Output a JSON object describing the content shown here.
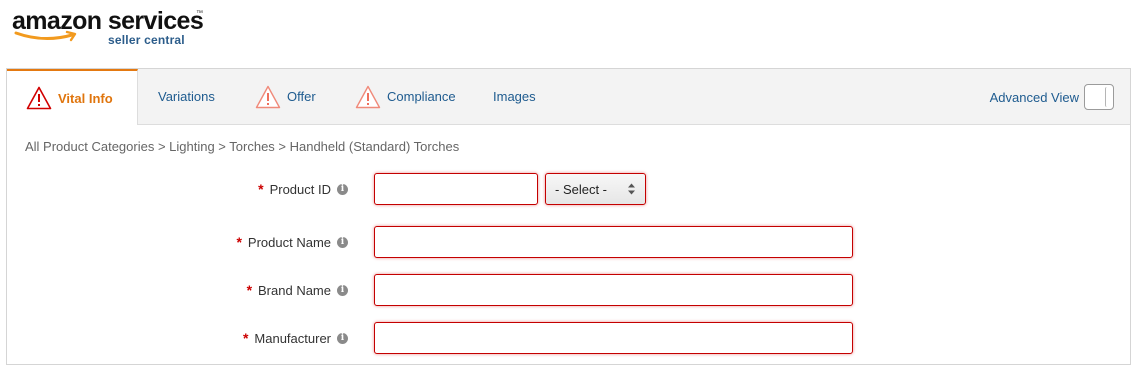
{
  "logo": {
    "brand": "amazon services",
    "sub": "seller central",
    "tm": "™"
  },
  "tabs": [
    {
      "label": "Vital Info",
      "warning": true,
      "active": true
    },
    {
      "label": "Variations",
      "warning": false,
      "active": false
    },
    {
      "label": "Offer",
      "warning": true,
      "active": false
    },
    {
      "label": "Compliance",
      "warning": true,
      "active": false
    },
    {
      "label": "Images",
      "warning": false,
      "active": false
    }
  ],
  "advanced_view": {
    "label": "Advanced View",
    "enabled": false
  },
  "breadcrumb": "All Product Categories > Lighting > Torches > Handheld (Standard) Torches",
  "form": {
    "product_id": {
      "label": "Product ID",
      "required_mark": "*",
      "value": "",
      "select_value": "- Select -"
    },
    "product_name": {
      "label": "Product Name",
      "required_mark": "*",
      "value": ""
    },
    "brand_name": {
      "label": "Brand Name",
      "required_mark": "*",
      "value": ""
    },
    "manufacturer": {
      "label": "Manufacturer",
      "required_mark": "*",
      "value": ""
    }
  },
  "info_glyph": "i",
  "colors": {
    "active_tab": "#e0750d",
    "link": "#1e5b8f",
    "required": "#cc0000",
    "error_border": "#c40000",
    "warning_red": "#d10000"
  }
}
